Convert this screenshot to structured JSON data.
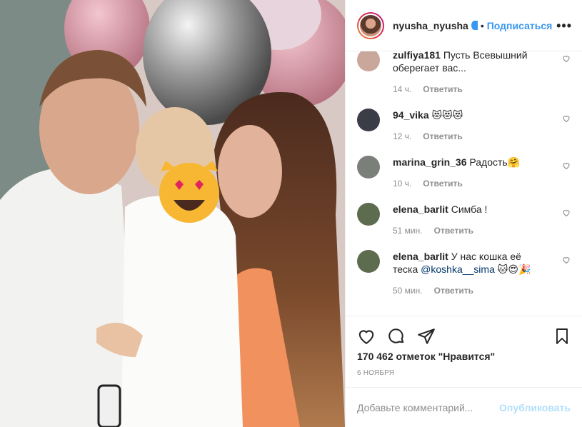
{
  "header": {
    "username": "nyusha_nyusha",
    "separator": "•",
    "follow_label": "Подписаться",
    "more_label": "•••"
  },
  "comments": [
    {
      "username": "zulfiya181",
      "text": "Пусть Всевышний оберегает вас...",
      "time": "14 ч.",
      "reply": "Ответить",
      "avatar_color": "#c9a79a"
    },
    {
      "username": "94_vika",
      "text": "😻😻😻",
      "time": "12 ч.",
      "reply": "Ответить",
      "avatar_color": "#3a3d45"
    },
    {
      "username": "marina_grin_36",
      "text": "Радость🤗",
      "time": "10 ч.",
      "reply": "Ответить",
      "avatar_color": "#7a8079"
    },
    {
      "username": "elena_barlit",
      "text": "Симба !",
      "time": "51 мин.",
      "reply": "Ответить",
      "avatar_color": "#5d6b4f"
    },
    {
      "username": "elena_barlit",
      "text": "У нас кошка её теска",
      "mention": "@koshka__sima",
      "emoji": "🐱😍🎉",
      "time": "50 мин.",
      "reply": "Ответить",
      "avatar_color": "#5d6b4f"
    }
  ],
  "actions": {
    "likes": "170 462 отметок \"Нравится\"",
    "date": "6 ноября"
  },
  "add_comment": {
    "placeholder": "Добавьте комментарий...",
    "publish_label": "Опубликовать"
  },
  "colors": {
    "link_blue": "#3897f0",
    "muted": "#8e8e8e",
    "publish_disabled": "#b2dffc"
  }
}
